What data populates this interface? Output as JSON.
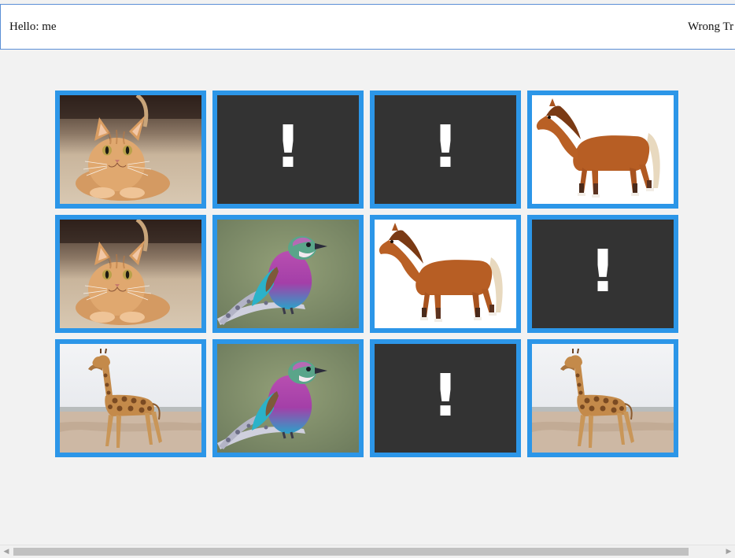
{
  "header": {
    "greeting": "Hello: me",
    "wrong_tries": "Wrong Tr"
  },
  "board": {
    "hidden_symbol": "!",
    "rows": [
      [
        {
          "state": "revealed",
          "image": "cat"
        },
        {
          "state": "hidden",
          "image": ""
        },
        {
          "state": "hidden",
          "image": ""
        },
        {
          "state": "revealed",
          "image": "horse"
        }
      ],
      [
        {
          "state": "revealed",
          "image": "cat"
        },
        {
          "state": "revealed",
          "image": "bird"
        },
        {
          "state": "revealed",
          "image": "horse"
        },
        {
          "state": "hidden",
          "image": ""
        }
      ],
      [
        {
          "state": "revealed",
          "image": "giraffe"
        },
        {
          "state": "revealed",
          "image": "bird"
        },
        {
          "state": "hidden",
          "image": ""
        },
        {
          "state": "revealed",
          "image": "giraffe"
        }
      ]
    ]
  },
  "colors": {
    "card_border": "#2c96e8",
    "hidden_card": "#333333",
    "header_border": "#5b8fd6"
  },
  "scrollbar": {
    "left_arrow": "◀",
    "right_arrow": "▶"
  }
}
